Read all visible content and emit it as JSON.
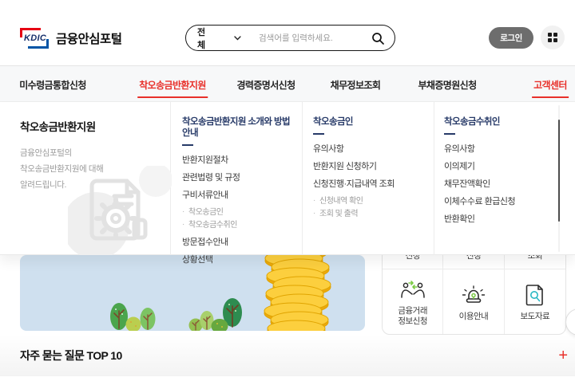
{
  "colors": {
    "accent_red": "#e8302a",
    "navy_heading": "#273a68",
    "banner_blue": "#cfe0ef",
    "coin_gold": "#f7bb10",
    "icon_green": "#7ac943",
    "icon_teal": "#2bb8c4",
    "logo_red": "#e60013",
    "logo_blue": "#0054a6"
  },
  "header": {
    "logo_text": "KDIC",
    "site_title": "금융안심포털",
    "search": {
      "category": "전체",
      "placeholder": "검색어를 입력하세요."
    },
    "login_label": "로그인"
  },
  "nav": {
    "items": [
      {
        "label": "미수령금통합신청"
      },
      {
        "label": "착오송금반환지원",
        "active": true
      },
      {
        "label": "경력증명서신청"
      },
      {
        "label": "채무정보조회"
      },
      {
        "label": "부채증명원신청"
      },
      {
        "label": "고객센터",
        "active": true
      }
    ]
  },
  "megamenu": {
    "intro": {
      "title": "착오송금반환지원",
      "desc_lines": [
        "금융안심포털의",
        "착오송금반환지원에 대해",
        "알려드립니다."
      ]
    },
    "columns": [
      {
        "title": "착오송금반환지원 소개와 방법 안내",
        "entries": [
          {
            "label": "반환지원절차",
            "sub": false
          },
          {
            "label": "관련법령 및 규정",
            "sub": false
          },
          {
            "label": "구비서류안내",
            "sub": false
          },
          {
            "label": "착오송금인",
            "sub": true
          },
          {
            "label": "착오송금수취인",
            "sub": true
          },
          {
            "label": "방문접수안내",
            "sub": false
          },
          {
            "label": "상황선택",
            "sub": false
          }
        ]
      },
      {
        "title": "착오송금인",
        "entries": [
          {
            "label": "유의사항",
            "sub": false
          },
          {
            "label": "반환지원 신청하기",
            "sub": false
          },
          {
            "label": "신청진행·지급내역 조회",
            "sub": false
          },
          {
            "label": "신청내역 확인",
            "sub": true
          },
          {
            "label": "조회 및 출력",
            "sub": true
          }
        ]
      },
      {
        "title": "착오송금수취인",
        "entries": [
          {
            "label": "유의사항",
            "sub": false
          },
          {
            "label": "이의제기",
            "sub": false
          },
          {
            "label": "채무잔액확인",
            "sub": false
          },
          {
            "label": "이체수수료 환급신청",
            "sub": false
          },
          {
            "label": "반환확인",
            "sub": false
          }
        ]
      }
    ]
  },
  "quickmenu": {
    "partial_labels": [
      "신청",
      "신청",
      "조회"
    ],
    "cells": [
      {
        "icon": "handshake-icon",
        "label_lines": [
          "금융거래",
          "정보신청"
        ]
      },
      {
        "icon": "siren-icon",
        "label_lines": [
          "이용안내"
        ]
      },
      {
        "icon": "document-search-icon",
        "label_lines": [
          "보도자료"
        ]
      }
    ]
  },
  "faq": {
    "title": "자주 묻는 질문 TOP 10",
    "expand_symbol": "+"
  }
}
